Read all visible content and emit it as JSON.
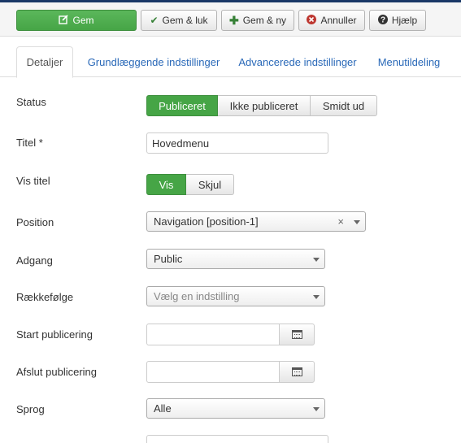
{
  "toolbar": {
    "save": "Gem",
    "save_close": "Gem & luk",
    "save_new": "Gem & ny",
    "cancel": "Annuller",
    "help": "Hjælp"
  },
  "tabs": [
    "Detaljer",
    "Grundlæggende indstillinger",
    "Advancerede indstillinger",
    "Menutildeling"
  ],
  "form": {
    "status": {
      "label": "Status",
      "options": [
        "Publiceret",
        "Ikke publiceret",
        "Smidt ud"
      ],
      "selected": "Publiceret"
    },
    "title": {
      "label": "Titel *",
      "value": "Hovedmenu"
    },
    "show_title": {
      "label": "Vis titel",
      "options": [
        "Vis",
        "Skjul"
      ],
      "selected": "Vis"
    },
    "position": {
      "label": "Position",
      "value": "Navigation [position-1]",
      "clear": "×"
    },
    "access": {
      "label": "Adgang",
      "value": "Public"
    },
    "ordering": {
      "label": "Rækkefølge",
      "placeholder": "Vælg en indstilling"
    },
    "publish_up": {
      "label": "Start publicering",
      "value": ""
    },
    "publish_down": {
      "label": "Afslut publicering",
      "value": ""
    },
    "language": {
      "label": "Sprog",
      "value": "Alle"
    }
  },
  "colors": {
    "primary_green": "#46a546",
    "link_blue": "#2a69b8",
    "header_navy": "#1a3867"
  }
}
